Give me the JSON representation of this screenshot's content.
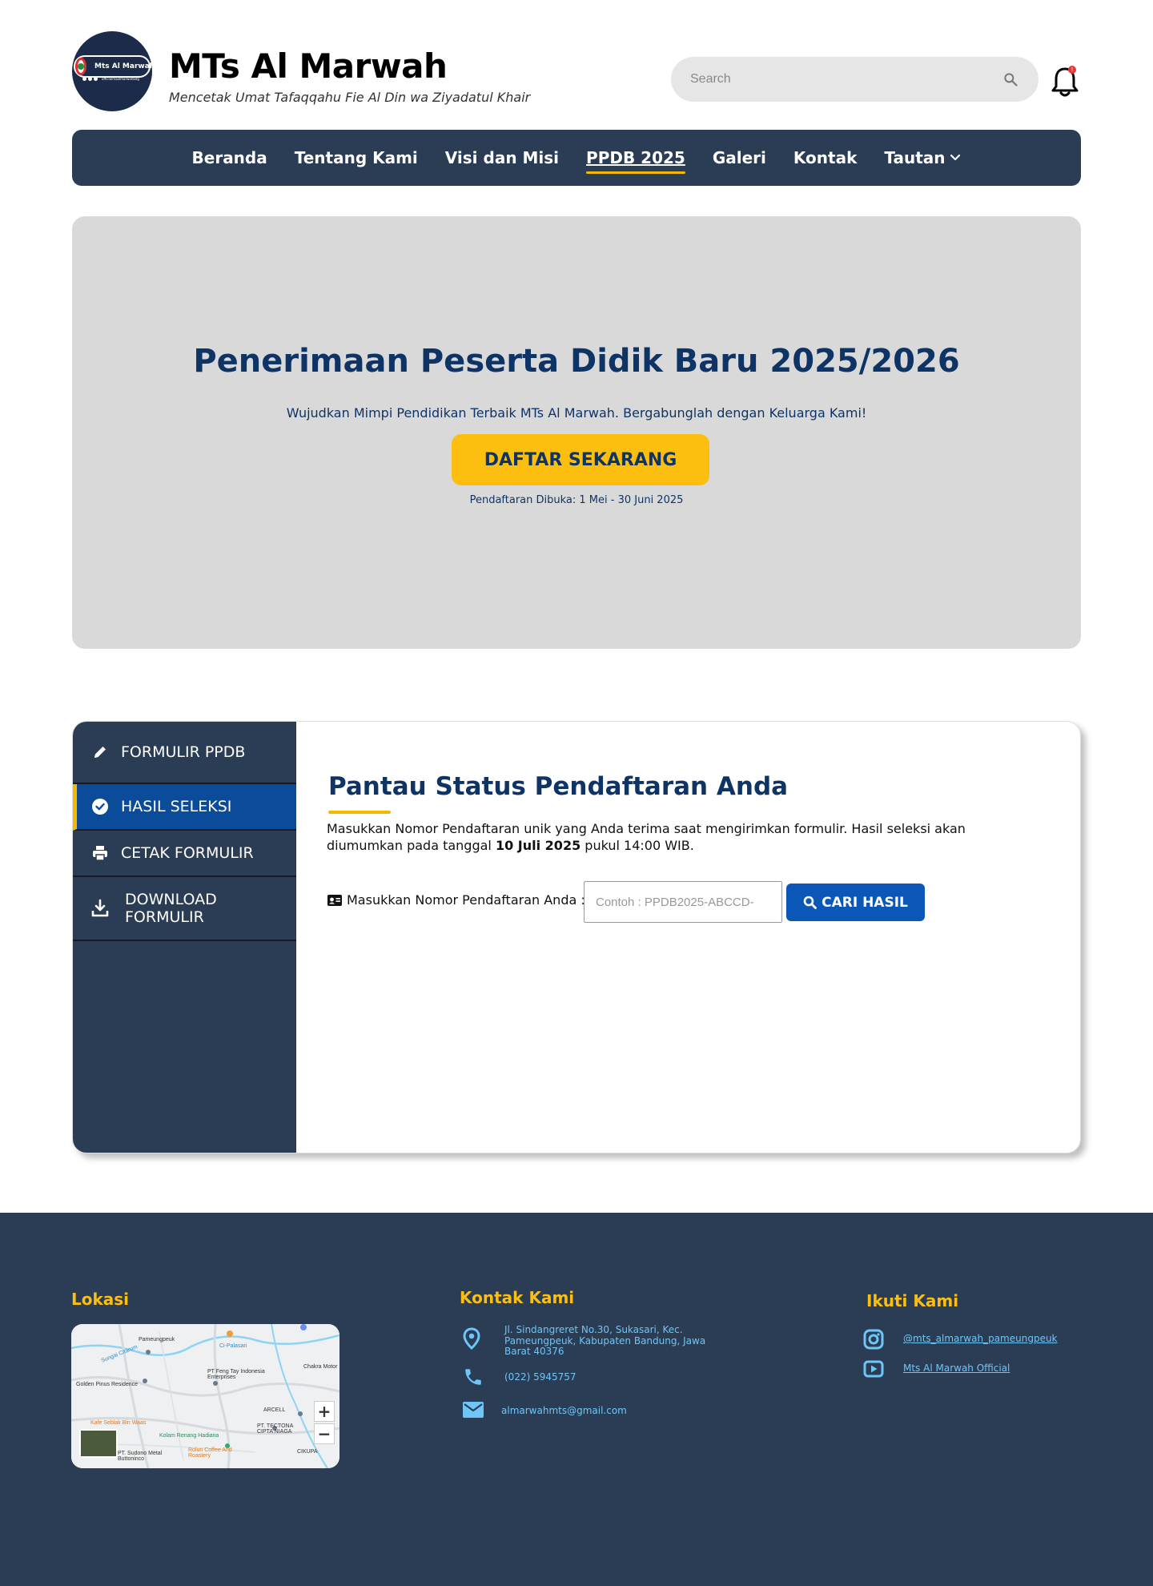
{
  "header": {
    "logo_text": "Mts Al Marwah",
    "logo_handle": "officialmaalmarwahbdg",
    "title": "MTs Al Marwah",
    "tagline": "Mencetak Umat Tafaqqahu Fie Al Din wa Ziyadatul Khair",
    "search_placeholder": "Search",
    "notification_badge": "!"
  },
  "nav": {
    "items": [
      {
        "label": "Beranda"
      },
      {
        "label": "Tentang Kami"
      },
      {
        "label": "Visi dan Misi"
      },
      {
        "label": "PPDB 2025"
      },
      {
        "label": "Galeri"
      },
      {
        "label": "Kontak"
      },
      {
        "label": "Tautan"
      }
    ],
    "active": "PPDB 2025"
  },
  "hero": {
    "title": "Penerimaan Peserta Didik Baru 2025/2026",
    "subtitle": "Wujudkan Mimpi Pendidikan Terbaik MTs Al Marwah. Bergabunglah dengan Keluarga Kami!",
    "cta_label": "DAFTAR SEKARANG",
    "note": "Pendaftaran Dibuka: 1 Mei - 30 Juni 2025"
  },
  "sidebar": {
    "items": [
      {
        "label": "FORMULIR PPDB",
        "icon": "pencil-icon"
      },
      {
        "label": "HASIL SELEKSI",
        "icon": "check-circle-icon"
      },
      {
        "label": "CETAK FORMULIR",
        "icon": "printer-icon"
      },
      {
        "label": "DOWNLOAD FORMULIR",
        "icon": "download-icon"
      }
    ],
    "active": "HASIL SELEKSI"
  },
  "content": {
    "title": "Pantau Status Pendaftaran Anda",
    "desc_part1": "Masukkan Nomor Pendaftaran unik yang Anda terima saat mengirimkan formulir. Hasil seleksi akan diumumkan pada tanggal ",
    "desc_bold": "10 Juli 2025",
    "desc_part2": " pukul 14:00 WIB.",
    "lookup_label": "Masukkan Nomor Pendaftaran Anda :",
    "lookup_placeholder": "Contoh : PPDB2025-ABCCD-",
    "lookup_button": "CARI HASIL"
  },
  "footer": {
    "location_title": "Lokasi",
    "contact_title": "Kontak Kami",
    "follow_title": "Ikuti Kami",
    "address": "Jl. Sindangreret No.30, Sukasari, Kec. Pameungpeuk, Kabupaten Bandung, Jawa Barat 40376",
    "phone": "(022) 5945757",
    "email": "almarwahmts@gmail.com",
    "instagram": "@mts_almarwah_pameungpeuk",
    "youtube": "Mts Al Marwah Official",
    "map_labels": {
      "pameungpeuk": "Pameungpeuk",
      "cipalasari": "Ci-Palasari",
      "golden": "Golden Pinus Residence",
      "feng": "PT Feng Tay Indonesia Enterprises",
      "chakra": "Chakra Motor",
      "arcell": "ARCELL",
      "tectona": "PT. TECTONA CIPTA NIAGA",
      "kafe": "Kafe Seblak Bin Waas",
      "kolam": "Kolam Renang Hadiana",
      "rolun": "Rolun Coffee And Roastery",
      "sudono": "PT. Sudono Metal Buttoninco",
      "cikupa": "CIKUPA",
      "sungai": "Sungai Citarum"
    },
    "zoom_in": "+",
    "zoom_out": "−"
  }
}
